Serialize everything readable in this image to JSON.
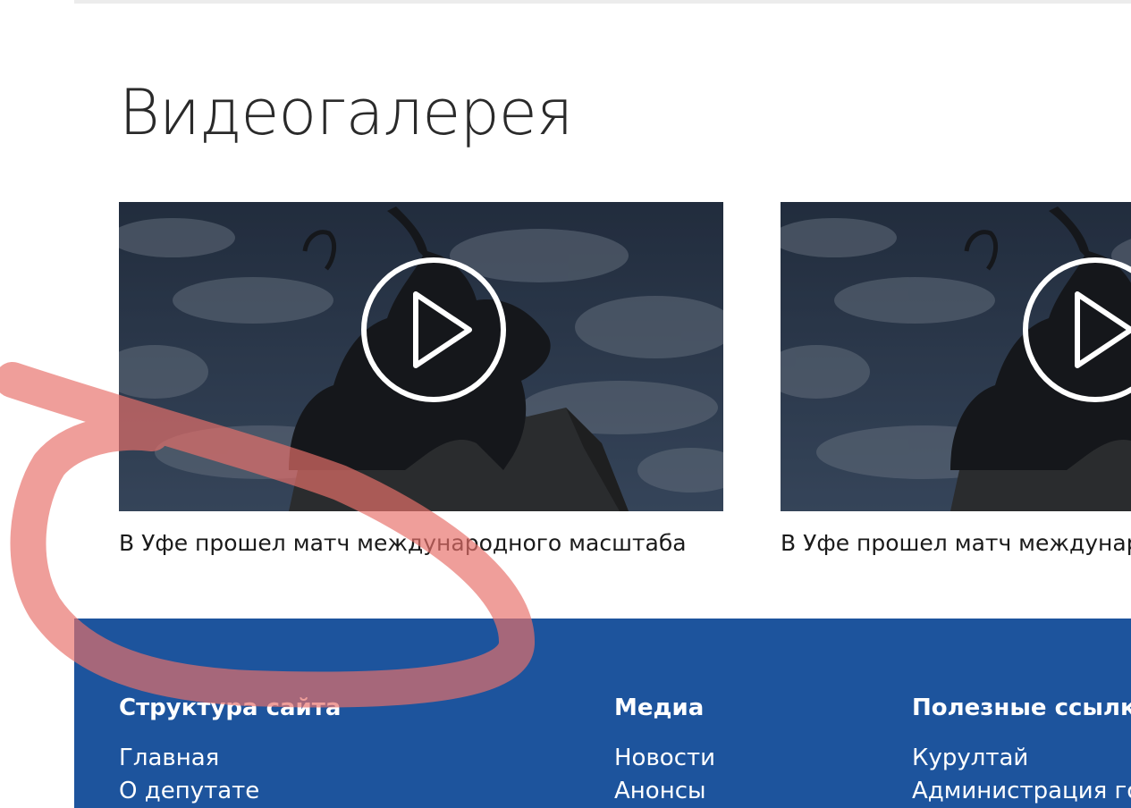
{
  "gallery": {
    "title": "Видеогалерея",
    "videos": [
      {
        "caption": "В Уфе прошел матч международного масштаба",
        "thumbnail": "salavat-yulaev-monument",
        "icon": "play-icon"
      },
      {
        "caption": "В Уфе прошел матч международного масштаба",
        "thumbnail": "salavat-yulaev-monument",
        "icon": "play-icon"
      }
    ]
  },
  "footer": {
    "background": "#1d549d",
    "columns": [
      {
        "heading": "Структура сайта",
        "links": [
          "Главная",
          "О депутате"
        ]
      },
      {
        "heading": "Медиа",
        "links": [
          "Новости",
          "Анонсы"
        ]
      },
      {
        "heading": "Полезные ссылки",
        "links": [
          "Курултай",
          "Администрация го"
        ]
      }
    ]
  },
  "annotation": {
    "type": "hand-drawn-circle",
    "color": "#e8706a"
  }
}
